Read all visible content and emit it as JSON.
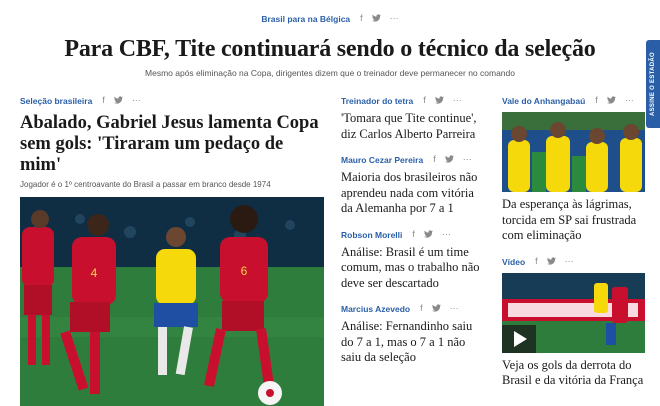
{
  "top": {
    "kicker": "Brasil para na Bélgica",
    "title": "Para CBF, Tite continuará sendo o técnico da seleção",
    "subtitle": "Mesmo após eliminação na Copa, dirigentes dizem que o treinador deve permanecer no comando"
  },
  "share_icons": {
    "facebook": "f",
    "twitter": "🐦",
    "more": "···"
  },
  "main": {
    "kicker": "Seleção brasileira",
    "title": "Abalado, Gabriel Jesus lamenta Copa sem gols: 'Tiraram um pedaço de mim'",
    "subtitle": "Jogador é o 1º centroavante do Brasil a passar em branco desde 1974"
  },
  "col2": [
    {
      "kicker": "Treinador do tetra",
      "title": "'Tomara que Tite continue', diz Carlos Alberto Parreira"
    },
    {
      "kicker": "Mauro Cezar Pereira",
      "title": "Maioria dos brasileiros não aprendeu nada com vitória da Alemanha por 7 a 1"
    },
    {
      "kicker": "Robson Morelli",
      "title": "Análise: Brasil é um time comum, mas o trabalho não deve ser descartado"
    },
    {
      "kicker": "Marcius Azevedo",
      "title": "Análise: Fernandinho saiu do 7 a 1, mas o 7 a 1 não saiu da seleção"
    }
  ],
  "col3": [
    {
      "kicker": "Vale do Anhangabaú",
      "title": "Da esperança às lágrimas, torcida em SP sai frustrada com eliminação"
    },
    {
      "kicker": "Vídeo",
      "title": "Veja os gols da derrota do Brasil e da vitória da França"
    }
  ],
  "side_tab": {
    "label": "ASSINE O ESTADÃO"
  },
  "colors": {
    "accent": "#2a5fa8",
    "belgium_red": "#c8102e",
    "brazil_yellow": "#f5d90a",
    "brazil_blue": "#1f4fa3"
  }
}
